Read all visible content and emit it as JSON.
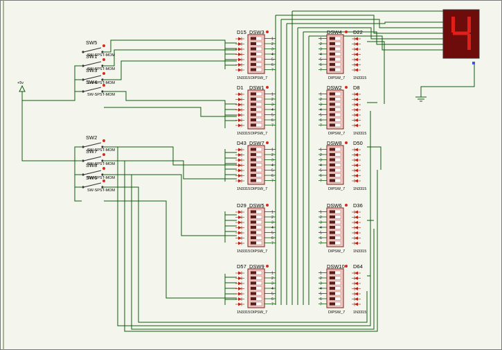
{
  "power": {
    "label": "+5v"
  },
  "seven_segment": {
    "digit": "4",
    "segment_color": "#e02018",
    "body_color": "#6e0b0b"
  },
  "switches": [
    {
      "label": "SW5",
      "part": "SW-SPST-MOM"
    },
    {
      "label": "SW1",
      "part": "SW-SPST-MOM"
    },
    {
      "label": "SW3",
      "part": "SW-SPST-MOM"
    },
    {
      "label": "SW4",
      "part": "SW-SPST-MOM"
    },
    {
      "label": "SW2",
      "part": "SW-SPST-MOM"
    },
    {
      "label": "SW7",
      "part": "SW-SPST-MOM"
    },
    {
      "label": "SW8",
      "part": "SW-SPST-MOM"
    },
    {
      "label": "SW6",
      "part": "SW-SPST-MOM"
    }
  ],
  "left_dips": [
    {
      "name": "DSW3",
      "diode": "D15",
      "part": "DIPSW_7",
      "diode_part": "1N3315"
    },
    {
      "name": "DSW1",
      "diode": "D1",
      "part": "DIPSW_7",
      "diode_part": "1N3315"
    },
    {
      "name": "DSW7",
      "diode": "D43",
      "part": "DIPSW_7",
      "diode_part": "1N3315"
    },
    {
      "name": "DSW5",
      "diode": "D29",
      "part": "DIPSW_7",
      "diode_part": "1N3315"
    },
    {
      "name": "DSW9",
      "diode": "D57",
      "part": "DIPSW_7",
      "diode_part": "1N3315"
    }
  ],
  "right_dips": [
    {
      "name": "DSW4",
      "diode": "D22",
      "part": "DIPSW_7",
      "diode_part": "1N3315"
    },
    {
      "name": "DSW2",
      "diode": "D8",
      "part": "DIPSW_7",
      "diode_part": "1N3315"
    },
    {
      "name": "DSW8",
      "diode": "D50",
      "part": "DIPSW_7",
      "diode_part": "1N3315"
    },
    {
      "name": "DSW6",
      "diode": "D36",
      "part": "DIPSW_7",
      "diode_part": "1N3315"
    },
    {
      "name": "DSW10",
      "diode": "D64",
      "part": "DIPSW_7",
      "diode_part": "1N3315"
    }
  ],
  "pin_numbers": [
    "1",
    "2",
    "3",
    "4",
    "5",
    "6",
    "7"
  ]
}
